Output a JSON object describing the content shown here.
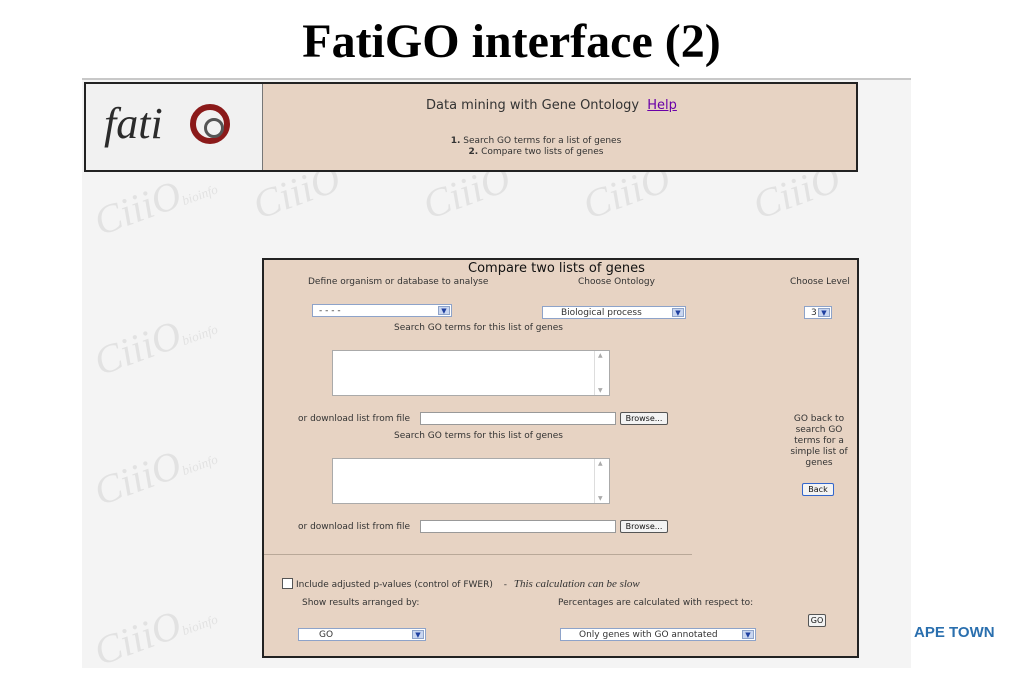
{
  "slide": {
    "title": "FatiGO interface (2)",
    "footer_brand": "APE TOWN"
  },
  "watermark": {
    "text": "CiiiO",
    "sub": "bioinfo"
  },
  "header": {
    "logo_text": "fati",
    "title": "Data mining with Gene Ontology",
    "help_link": "Help",
    "items": [
      {
        "num": "1.",
        "label": "Search GO terms for a list of genes"
      },
      {
        "num": "2.",
        "label": "Compare two lists of genes"
      }
    ]
  },
  "form": {
    "title": "Compare two lists of genes",
    "organism_label": "Define organism or database to analyse",
    "organism_value": "- - - -",
    "ontology_label": "Choose Ontology",
    "ontology_value": "Biological process",
    "level_label": "Choose Level",
    "level_value": "3",
    "list1_label": "Search GO terms for this list of genes",
    "list2_label": "Search GO terms for this list of genes",
    "download_label_1": "or download list from file",
    "download_label_2": "or download list from file",
    "browse_label": "Browse...",
    "go_back_text": "GO back to search GO terms for a simple list of genes",
    "back_button": "Back",
    "fwer_label": "Include adjusted p-values (control of FWER)",
    "fwer_dash": "-",
    "fwer_note": "This calculation can be slow",
    "show_results_label": "Show results arranged by:",
    "show_results_value": "GO",
    "percentages_label": "Percentages are calculated with respect to:",
    "percentages_value": "Only genes with GO annotated",
    "go_button": "GO"
  }
}
